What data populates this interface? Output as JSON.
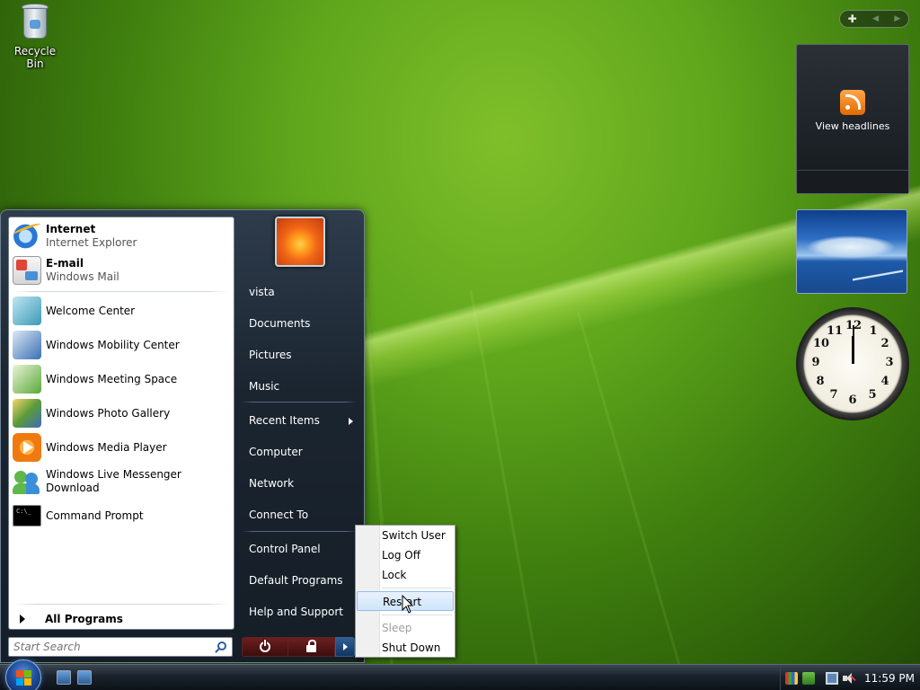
{
  "desktop": {
    "recycle_bin_label": "Recycle Bin"
  },
  "gadgets": {
    "feed_text": "View headlines"
  },
  "start_menu": {
    "pinned": [
      {
        "title": "Internet",
        "subtitle": "Internet Explorer",
        "icon": "internet-explorer-icon"
      },
      {
        "title": "E-mail",
        "subtitle": "Windows Mail",
        "icon": "windows-mail-icon"
      }
    ],
    "recent": [
      {
        "label": "Welcome Center",
        "icon": "welcome-center-icon"
      },
      {
        "label": "Windows Mobility Center",
        "icon": "mobility-center-icon"
      },
      {
        "label": "Windows Meeting Space",
        "icon": "meeting-space-icon"
      },
      {
        "label": "Windows Photo Gallery",
        "icon": "photo-gallery-icon"
      },
      {
        "label": "Windows Media Player",
        "icon": "media-player-icon"
      },
      {
        "label": "Windows Live Messenger Download",
        "icon": "messenger-icon"
      },
      {
        "label": "Command Prompt",
        "icon": "command-prompt-icon"
      }
    ],
    "all_programs": "All Programs",
    "search_placeholder": "Start Search",
    "right": {
      "user": "vista",
      "documents": "Documents",
      "pictures": "Pictures",
      "music": "Music",
      "recent_items": "Recent Items",
      "computer": "Computer",
      "network": "Network",
      "connect_to": "Connect To",
      "control_panel": "Control Panel",
      "default_programs": "Default Programs",
      "help_support": "Help and Support"
    }
  },
  "shutdown_menu": {
    "switch_user": "Switch User",
    "log_off": "Log Off",
    "lock": "Lock",
    "restart": "Restart",
    "sleep": "Sleep",
    "shut_down": "Shut Down"
  },
  "taskbar": {
    "clock": "11:59 PM"
  },
  "colors": {
    "menu_dark": "#1b2530",
    "power_red": "#6c1f1f",
    "highlight": "#cfe5fb"
  }
}
